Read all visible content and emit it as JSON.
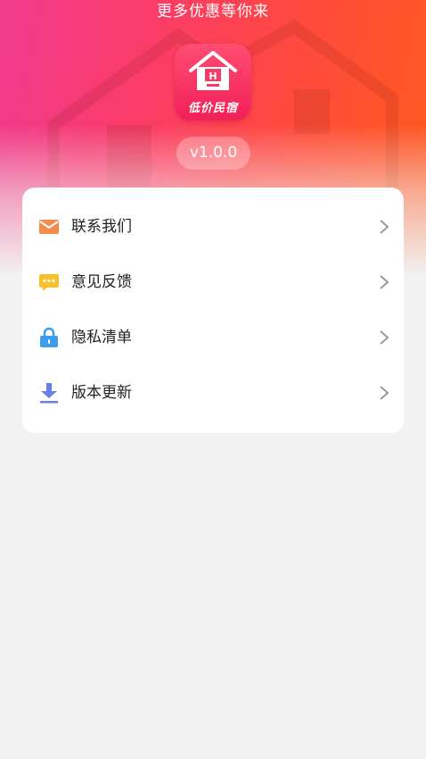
{
  "header": {
    "tagline": "更多优惠等你来",
    "logo_text": "低价民宿",
    "logo_icon": "house-icon",
    "version": "v1.0.0",
    "gradient_colors": [
      "#f03a8e",
      "#ff4a3d",
      "#ff5a1e"
    ]
  },
  "menu": {
    "items": [
      {
        "label": "联系我们",
        "icon": "mail-icon",
        "color": "#f38c4a"
      },
      {
        "label": "意见反馈",
        "icon": "chat-bubble-icon",
        "color": "#f7c02c"
      },
      {
        "label": "隐私清单",
        "icon": "lock-icon",
        "color": "#3f9bf0"
      },
      {
        "label": "版本更新",
        "icon": "download-icon",
        "color": "#6b7ee8"
      }
    ],
    "chevron_icon": "chevron-right-icon"
  }
}
